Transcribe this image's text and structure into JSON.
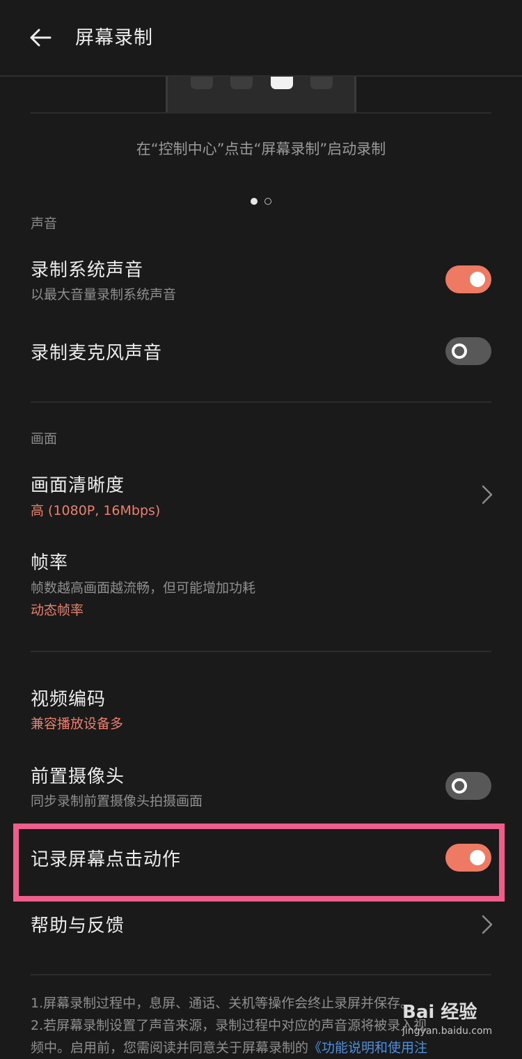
{
  "header": {
    "title": "屏幕录制"
  },
  "carousel": {
    "caption": "在“控制中心”点击“屏幕录制”启动录制",
    "page": 1,
    "pages": 2
  },
  "sound": {
    "section_label": "声音",
    "system_audio": {
      "title": "录制系统声音",
      "subtitle": "以最大音量录制系统声音",
      "enabled": true
    },
    "mic_audio": {
      "title": "录制麦克风声音",
      "enabled": false
    }
  },
  "picture": {
    "section_label": "画面",
    "resolution": {
      "title": "画面清晰度",
      "value": "高 (1080P, 16Mbps)"
    },
    "frame_rate": {
      "title": "帧率",
      "subtitle": "帧数越高画面越流畅，但可能增加功耗",
      "value": "动态帧率"
    }
  },
  "video_codec": {
    "title": "视频编码",
    "value": "兼容播放设备多"
  },
  "front_camera": {
    "title": "前置摄像头",
    "subtitle": "同步录制前置摄像头拍摄画面",
    "enabled": false
  },
  "record_taps": {
    "title": "记录屏幕点击动作",
    "enabled": true
  },
  "help": {
    "title": "帮助与反馈"
  },
  "notes": {
    "line1": "1.屏幕录制过程中，息屏、通话、关机等操作会终止录屏并保存。",
    "line2": "2.若屏幕录制设置了声音来源，录制过程中对应的声音源将被录入视",
    "line3_prefix": "频中。启用前，您需阅读并同意关于屏幕录制的",
    "line3_link": "《功能说明和使用注"
  },
  "watermark": {
    "brand": "Bai 经验",
    "url": "jingyan.baidu.com"
  },
  "colors": {
    "accent": "#ef7a64",
    "highlight": "#ec5f8c",
    "link": "#4d8fe0"
  }
}
